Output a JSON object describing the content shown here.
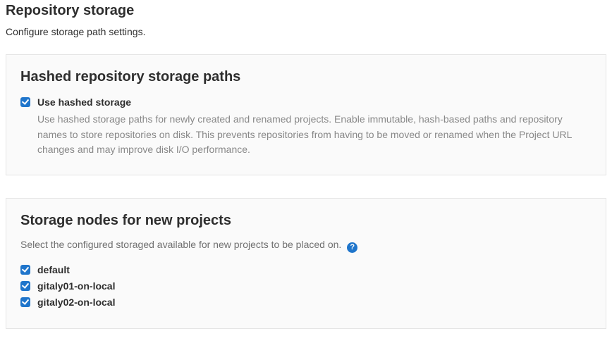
{
  "page": {
    "title": "Repository storage",
    "subtitle": "Configure storage path settings."
  },
  "hashed_panel": {
    "title": "Hashed repository storage paths",
    "checkbox_label": "Use hashed storage",
    "help_text": "Use hashed storage paths for newly created and renamed projects. Enable immutable, hash-based paths and repository names to store repositories on disk. This prevents repositories from having to be moved or renamed when the Project URL changes and may improve disk I/O performance."
  },
  "nodes_panel": {
    "title": "Storage nodes for new projects",
    "description": "Select the configured storaged available for new projects to be placed on.",
    "help_icon": "?",
    "nodes": [
      {
        "label": "default"
      },
      {
        "label": "gitaly01-on-local"
      },
      {
        "label": "gitaly02-on-local"
      }
    ]
  }
}
